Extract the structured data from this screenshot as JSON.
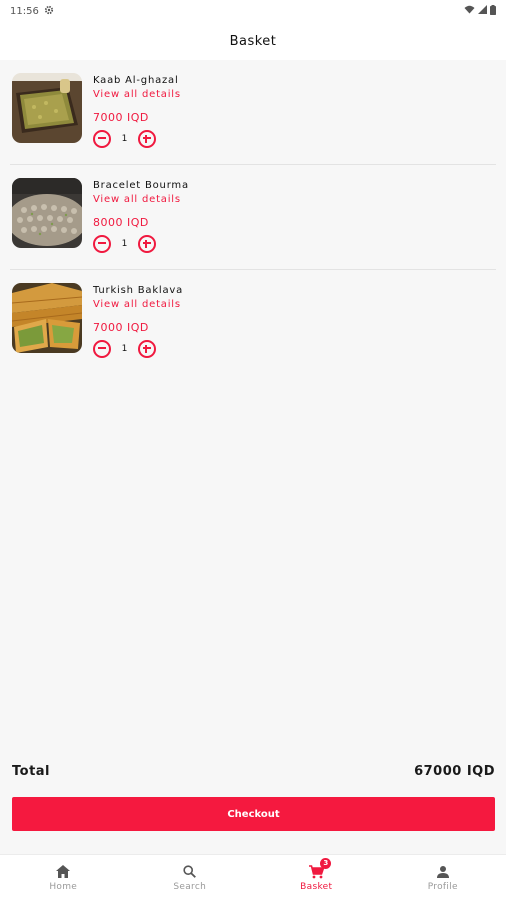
{
  "status_bar": {
    "time": "11:56",
    "icons": [
      "settings-gear-icon",
      "wifi-icon",
      "signal-icon",
      "battery-icon"
    ]
  },
  "app_bar": {
    "title": "Basket"
  },
  "basket": {
    "items": [
      {
        "name": "Kaab Al-ghazal",
        "details_label": "View all details",
        "price": "7000 IQD",
        "quantity": "1",
        "image": "pistachio-tray"
      },
      {
        "name": "Bracelet Bourma",
        "details_label": "View all details",
        "price": "8000 IQD",
        "quantity": "1",
        "image": "bourma-tray"
      },
      {
        "name": "Turkish Baklava",
        "details_label": "View all details",
        "price": "7000 IQD",
        "quantity": "1",
        "image": "baklava-slices"
      }
    ]
  },
  "summary": {
    "total_label": "Total",
    "total_value": "67000 IQD",
    "checkout_label": "Checkout"
  },
  "bottom_nav": {
    "items": [
      {
        "label": "Home",
        "icon": "home-icon",
        "active": false
      },
      {
        "label": "Search",
        "icon": "search-icon",
        "active": false
      },
      {
        "label": "Basket",
        "icon": "cart-icon",
        "active": true,
        "badge": "3"
      },
      {
        "label": "Profile",
        "icon": "person-icon",
        "active": false
      }
    ]
  },
  "colors": {
    "accent": "#f0193f",
    "background": "#f7f7f7",
    "surface": "#ffffff",
    "text": "#111111",
    "muted": "#9a9a9a"
  }
}
